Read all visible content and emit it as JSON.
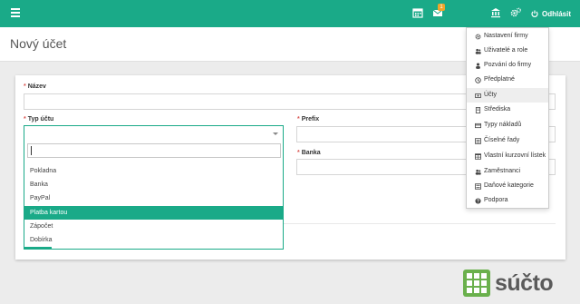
{
  "topbar": {
    "mail_badge": "1",
    "logout_label": "Odhlásit",
    "accent_color": "#1aaa88",
    "icons": [
      "hamburger-icon",
      "calendar-icon",
      "envelope-icon",
      "bank-icon",
      "cogs-icon",
      "power-icon"
    ]
  },
  "page": {
    "title": "Nový účet"
  },
  "form": {
    "name": {
      "asterisk": "*",
      "label": "Název",
      "value": ""
    },
    "type": {
      "asterisk": "*",
      "label": "Typ účtu",
      "search_value": "",
      "options": [
        "Pokladna",
        "Banka",
        "PayPal",
        "Platba kartou",
        "Zápočet",
        "Dobírka"
      ],
      "highlighted": "Platba kartou"
    },
    "prefix": {
      "asterisk": "*",
      "label": "Prefix",
      "value": ""
    },
    "bank": {
      "asterisk": "*",
      "label": "Banka",
      "value": ""
    }
  },
  "menu": {
    "items": [
      {
        "label": "Nastavení firmy",
        "icon": "cog-icon"
      },
      {
        "label": "Uživatelé a role",
        "icon": "users-icon"
      },
      {
        "label": "Pozvání do firmy",
        "icon": "user-icon"
      },
      {
        "label": "Předplatné",
        "icon": "clock-icon"
      },
      {
        "label": "Účty",
        "icon": "money-icon"
      },
      {
        "label": "Střediska",
        "icon": "building-icon"
      },
      {
        "label": "Typy nákladů",
        "icon": "credit-card-icon"
      },
      {
        "label": "Číselné řady",
        "icon": "list-icon"
      },
      {
        "label": "Vlastní kurzovní lístek",
        "icon": "table-icon"
      },
      {
        "label": "Zaměstnanci",
        "icon": "users-icon"
      },
      {
        "label": "Daňové kategorie",
        "icon": "tasks-icon"
      },
      {
        "label": "Podpora",
        "icon": "question-icon"
      }
    ],
    "active": "Účty"
  },
  "logo": {
    "text": "súčto"
  }
}
